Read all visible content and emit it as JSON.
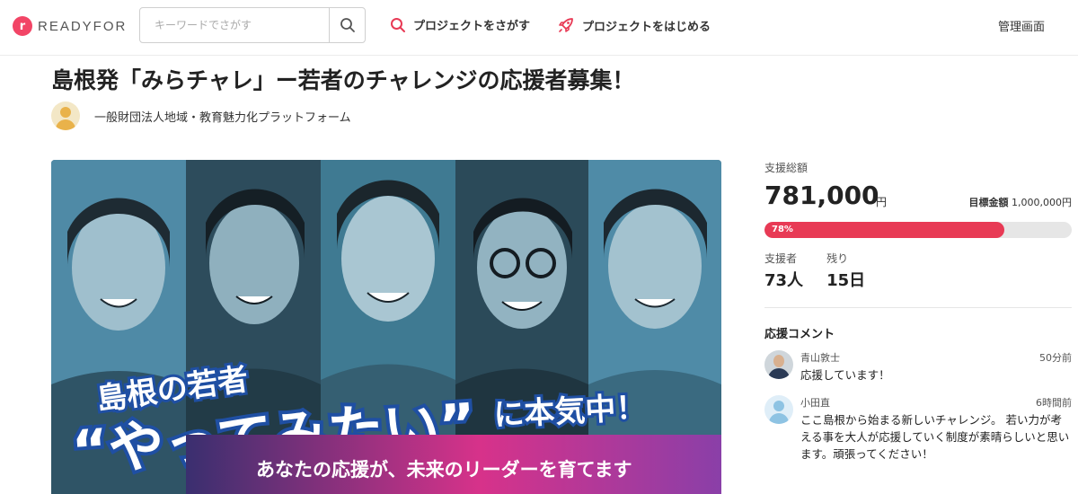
{
  "header": {
    "logo_text": "READYFOR",
    "search_placeholder": "キーワードでさがす",
    "nav_find": "プロジェクトをさがす",
    "nav_start": "プロジェクトをはじめる",
    "admin": "管理画面"
  },
  "project": {
    "title": "島根発「みらチャレ」ー若者のチャレンジの応援者募集！",
    "organization": "一般財団法人地域・教育魅力化プラットフォーム"
  },
  "hero": {
    "line1": "島根の若者",
    "line2": "“やってみたい”",
    "line3": "に本気中！",
    "banner": "あなたの応援が、未来のリーダーを育てます"
  },
  "funding": {
    "raised_label": "支援総額",
    "raised": "781,000",
    "currency": "円",
    "goal_label": "目標金額",
    "goal": "1,000,000円",
    "progress_text": "78%",
    "progress_fraction": 0.78,
    "supporters_label": "支援者",
    "supporters": "73人",
    "remaining_label": "残り",
    "remaining": "15日"
  },
  "comments": {
    "heading": "応援コメント",
    "items": [
      {
        "name": "青山敦士",
        "time": "50分前",
        "text": "応援しています！"
      },
      {
        "name": "小田直",
        "time": "6時間前",
        "text": "ここ島根から始まる新しいチャレンジ。 若い力が考える事を大人が応援していく制度が素晴らしいと思います。頑張ってください！"
      }
    ]
  },
  "colors": {
    "accent": "#e83a55",
    "brand": "#f24566"
  }
}
